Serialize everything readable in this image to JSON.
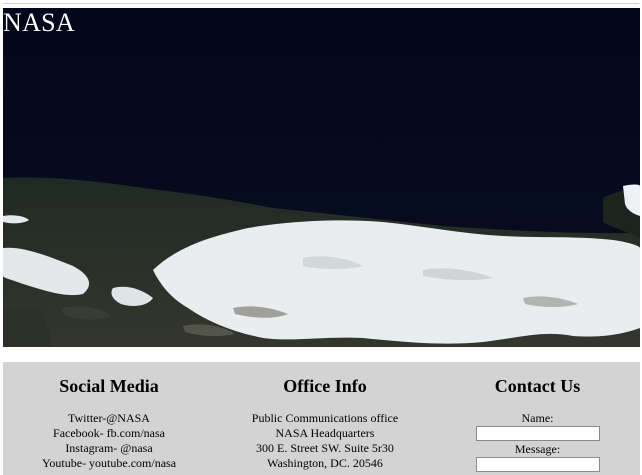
{
  "hero": {
    "title": "NASA"
  },
  "footer": {
    "social": {
      "heading": "Social Media",
      "items": [
        "Twitter-@NASA",
        "Facebook- fb.com/nasa",
        "Instagram- @nasa",
        "Youtube- youtube.com/nasa"
      ]
    },
    "office": {
      "heading": "Office Info",
      "lines": [
        "Public Communications office",
        "NASA Headquarters",
        "300 E. Street SW. Suite 5r30",
        "Washington, DC. 20546"
      ]
    },
    "contact": {
      "heading": "Contact Us",
      "name_label": "Name:",
      "name_value": "",
      "message_label": "Message:",
      "message_value": ""
    }
  },
  "colors": {
    "footer_bg": "#d3d3d3",
    "hero_sky": "#050a1a",
    "snow": "#eef1f3"
  }
}
